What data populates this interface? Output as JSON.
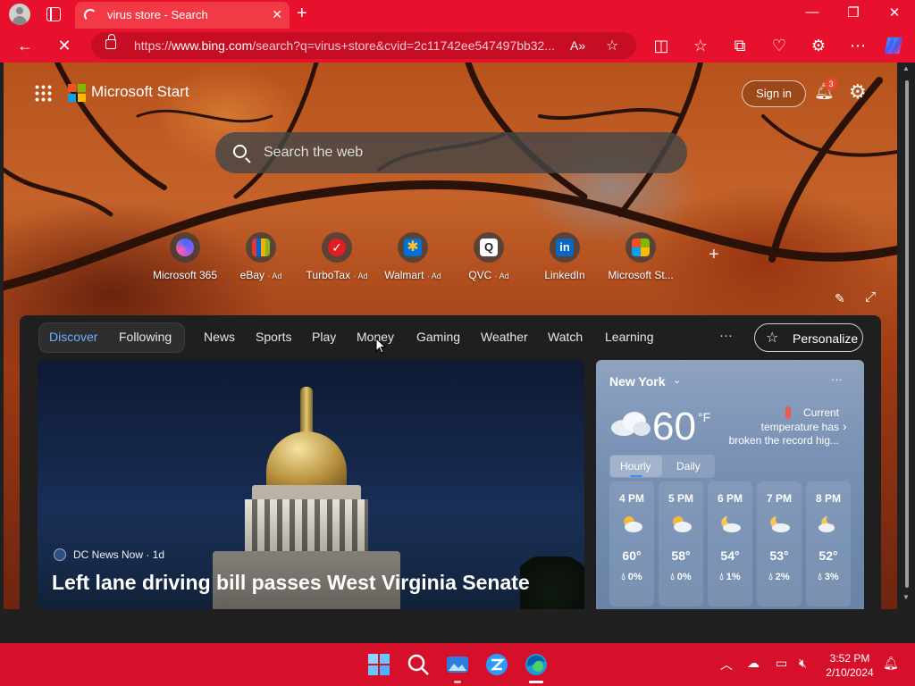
{
  "browser": {
    "tab_title": "virus store - Search",
    "url_prefix": "https://",
    "url_host": "www.bing.com",
    "url_path": "/search?q=virus+store&cvid=2c11742ee547497bb32..."
  },
  "header": {
    "brand": "Microsoft Start",
    "sign_in": "Sign in",
    "notification_count": "3"
  },
  "search": {
    "placeholder": "Search the web"
  },
  "quick_links": [
    {
      "label": "Microsoft 365",
      "ad": ""
    },
    {
      "label": "eBay",
      "ad": "· Ad"
    },
    {
      "label": "TurboTax",
      "ad": "· Ad"
    },
    {
      "label": "Walmart",
      "ad": "· Ad"
    },
    {
      "label": "QVC",
      "ad": "· Ad"
    },
    {
      "label": "LinkedIn",
      "ad": ""
    },
    {
      "label": "Microsoft St...",
      "ad": ""
    }
  ],
  "feed_nav": {
    "discover": "Discover",
    "following": "Following",
    "items": [
      "News",
      "Sports",
      "Play",
      "Money",
      "Gaming",
      "Weather",
      "Watch",
      "Learning"
    ],
    "more": "···",
    "personalize": "Personalize"
  },
  "story": {
    "source": "DC News Now · 1d",
    "title": "Left lane driving bill passes West Virginia Senate"
  },
  "weather": {
    "city": "New York",
    "temp": "60",
    "unit": "°F",
    "alert_line1": "Current",
    "alert_line2": "temperature has",
    "alert_line3": "broken the record hig...",
    "tab_hourly": "Hourly",
    "tab_daily": "Daily",
    "hours": [
      {
        "time": "4 PM",
        "temp": "60°",
        "precip": "0%"
      },
      {
        "time": "5 PM",
        "temp": "58°",
        "precip": "0%"
      },
      {
        "time": "6 PM",
        "temp": "54°",
        "precip": "1%"
      },
      {
        "time": "7 PM",
        "temp": "53°",
        "precip": "2%"
      },
      {
        "time": "8 PM",
        "temp": "52°",
        "precip": "3%"
      }
    ]
  },
  "taskbar": {
    "time": "3:52 PM",
    "date": "2/10/2024"
  }
}
